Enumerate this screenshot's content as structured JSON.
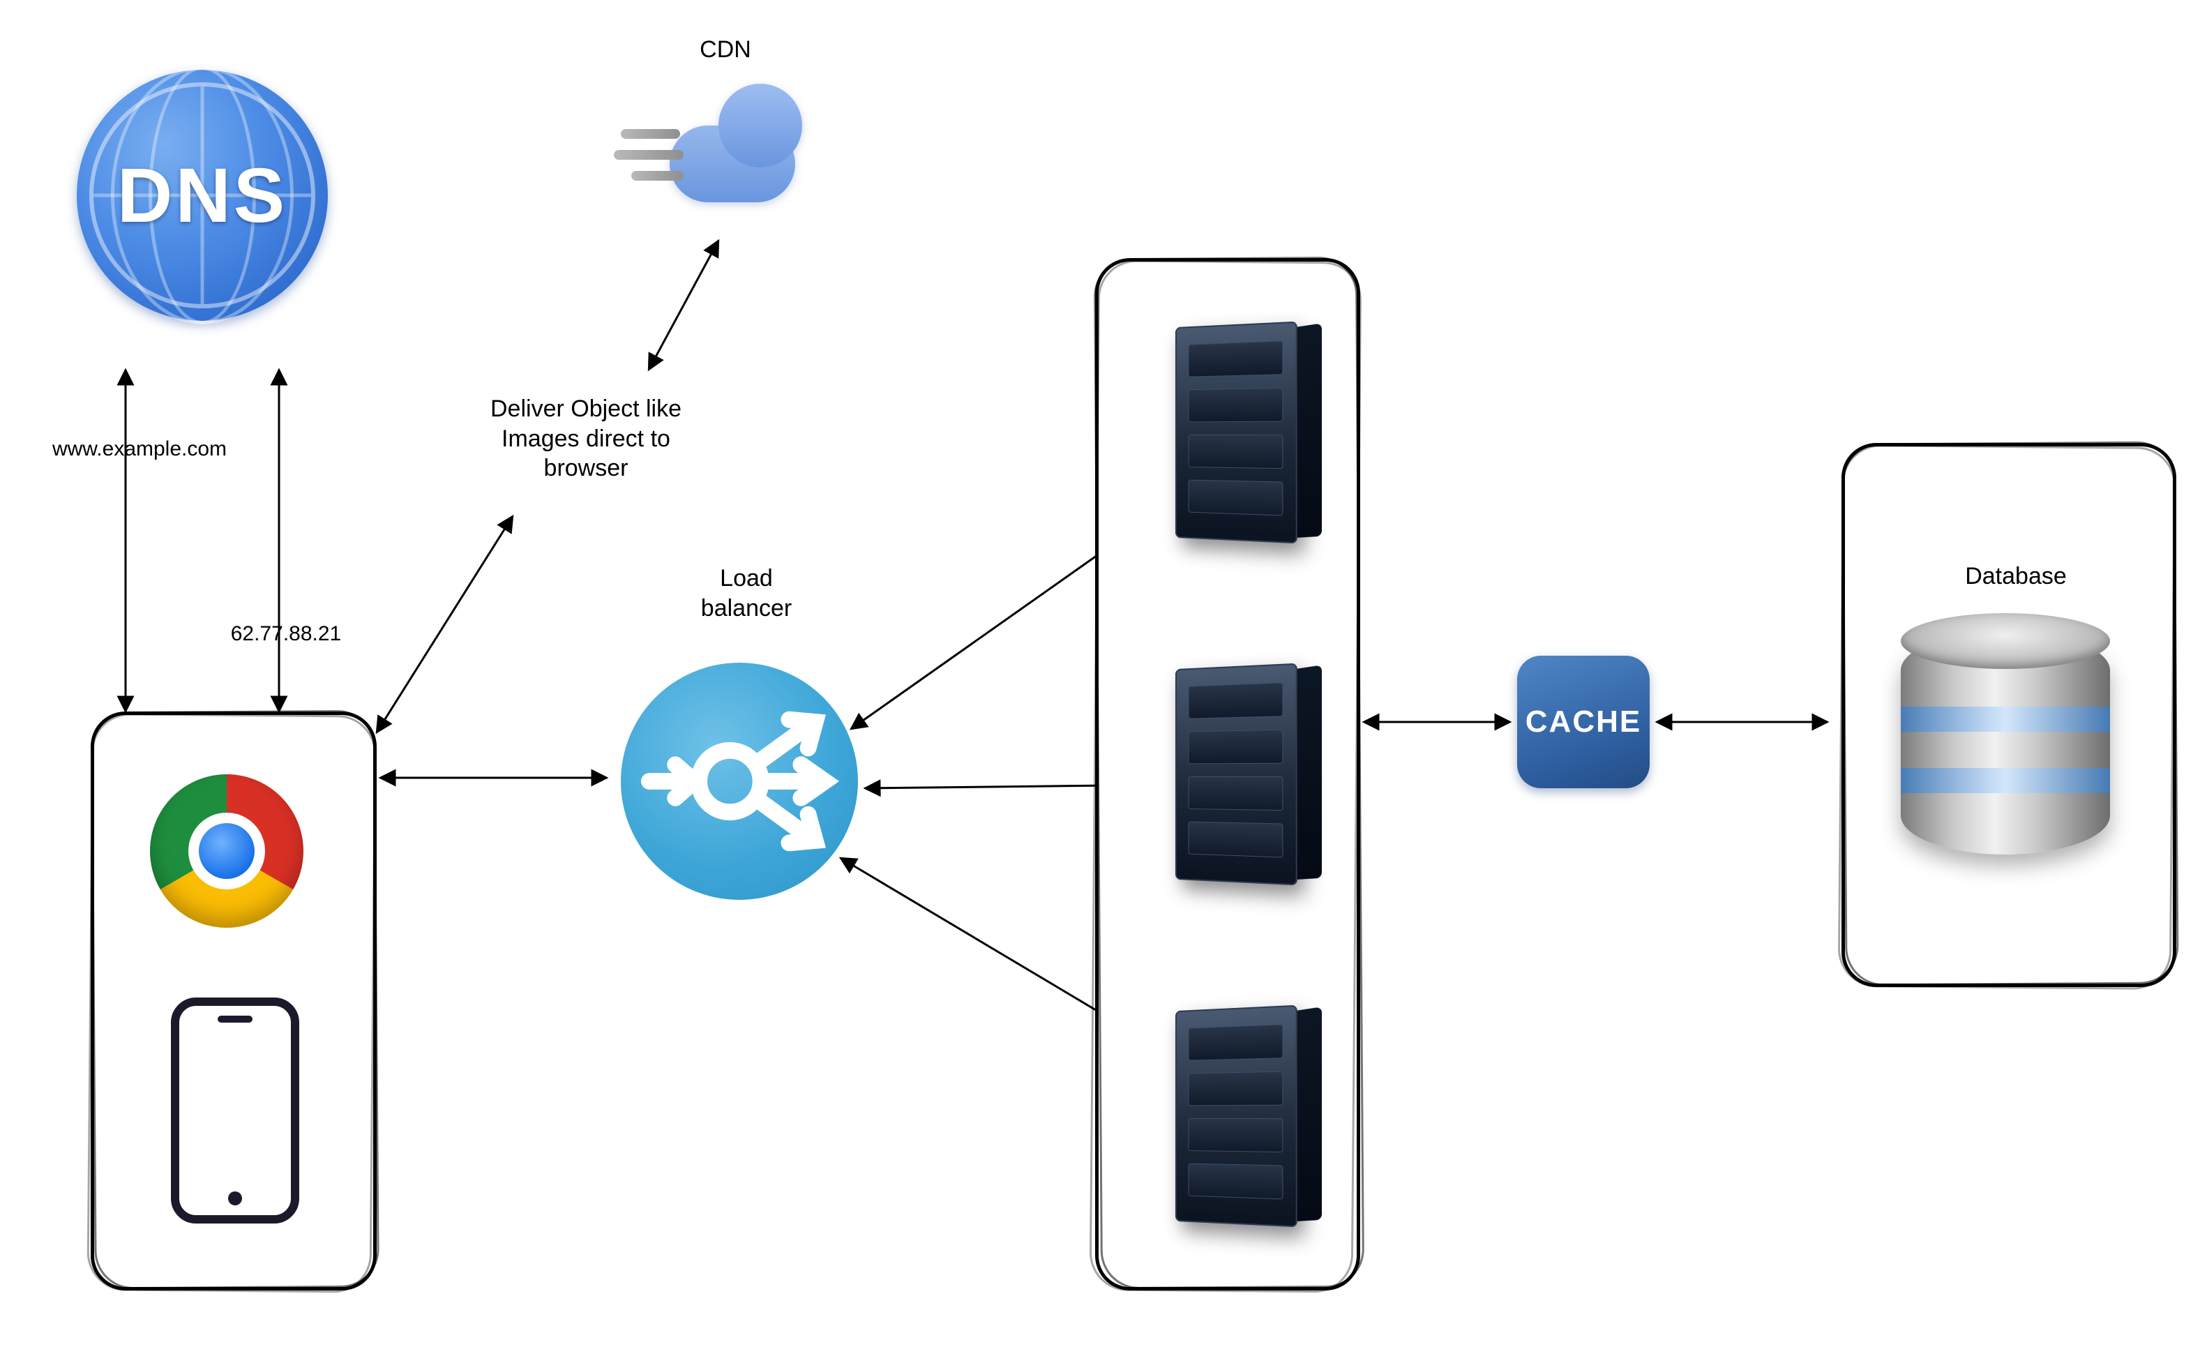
{
  "nodes": {
    "dns": {
      "label": "DNS"
    },
    "cdn": {
      "label": "CDN"
    },
    "client": {
      "label": ""
    },
    "load_balancer": {
      "label": "Load\nbalancer"
    },
    "servers": {
      "label": ""
    },
    "cache": {
      "label": "CACHE"
    },
    "database": {
      "label": "Database"
    }
  },
  "edge_labels": {
    "client_to_dns": "www.example.com",
    "dns_to_client": "62.77.88.21",
    "client_to_cdn": "Deliver Object like\nImages direct to\nbrowser"
  },
  "edges": [
    {
      "from": "client",
      "to": "dns",
      "label_key": "client_to_dns",
      "direction": "both"
    },
    {
      "from": "dns",
      "to": "client",
      "label_key": "dns_to_client",
      "direction": "both"
    },
    {
      "from": "client",
      "to": "cdn",
      "label_key": "client_to_cdn",
      "direction": "both"
    },
    {
      "from": "client",
      "to": "load_balancer",
      "direction": "both"
    },
    {
      "from": "load_balancer",
      "to": "servers[0]",
      "direction": "both"
    },
    {
      "from": "load_balancer",
      "to": "servers[1]",
      "direction": "both"
    },
    {
      "from": "load_balancer",
      "to": "servers[2]",
      "direction": "both"
    },
    {
      "from": "servers",
      "to": "cache",
      "direction": "both"
    },
    {
      "from": "cache",
      "to": "database",
      "direction": "both"
    }
  ]
}
